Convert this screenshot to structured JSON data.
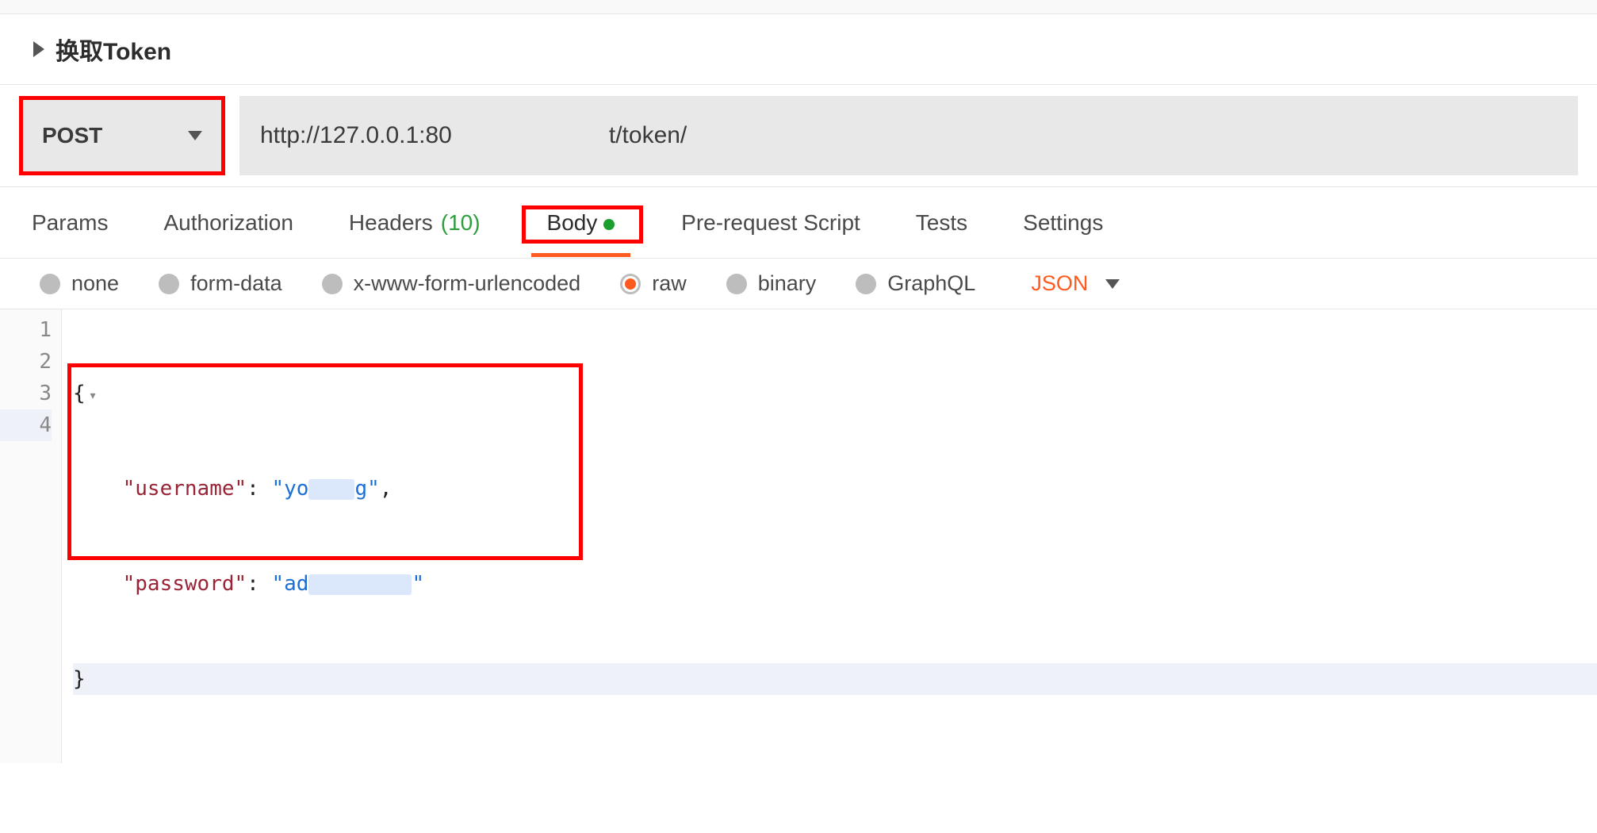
{
  "request_name": "换取Token",
  "method": "POST",
  "url_prefix": "http://127.0.0.1:80",
  "url_suffix": "t/token/",
  "tabs": {
    "params": "Params",
    "authorization": "Authorization",
    "headers": "Headers",
    "headers_count": "(10)",
    "body": "Body",
    "pre_request": "Pre-request Script",
    "tests": "Tests",
    "settings": "Settings"
  },
  "body_types": {
    "none": "none",
    "form_data": "form-data",
    "urlencoded": "x-www-form-urlencoded",
    "raw": "raw",
    "binary": "binary",
    "graphql": "GraphQL"
  },
  "raw_format": "JSON",
  "editor": {
    "line_numbers": [
      "1",
      "2",
      "3",
      "4"
    ],
    "key_username": "\"username\"",
    "val_username_pre": "\"yo",
    "val_username_post": "g\"",
    "key_password": "\"password\"",
    "val_password_pre": "\"ad",
    "val_password_post": "\"",
    "brace_open": "{",
    "brace_close": "}",
    "colon": ":",
    "comma": ","
  }
}
